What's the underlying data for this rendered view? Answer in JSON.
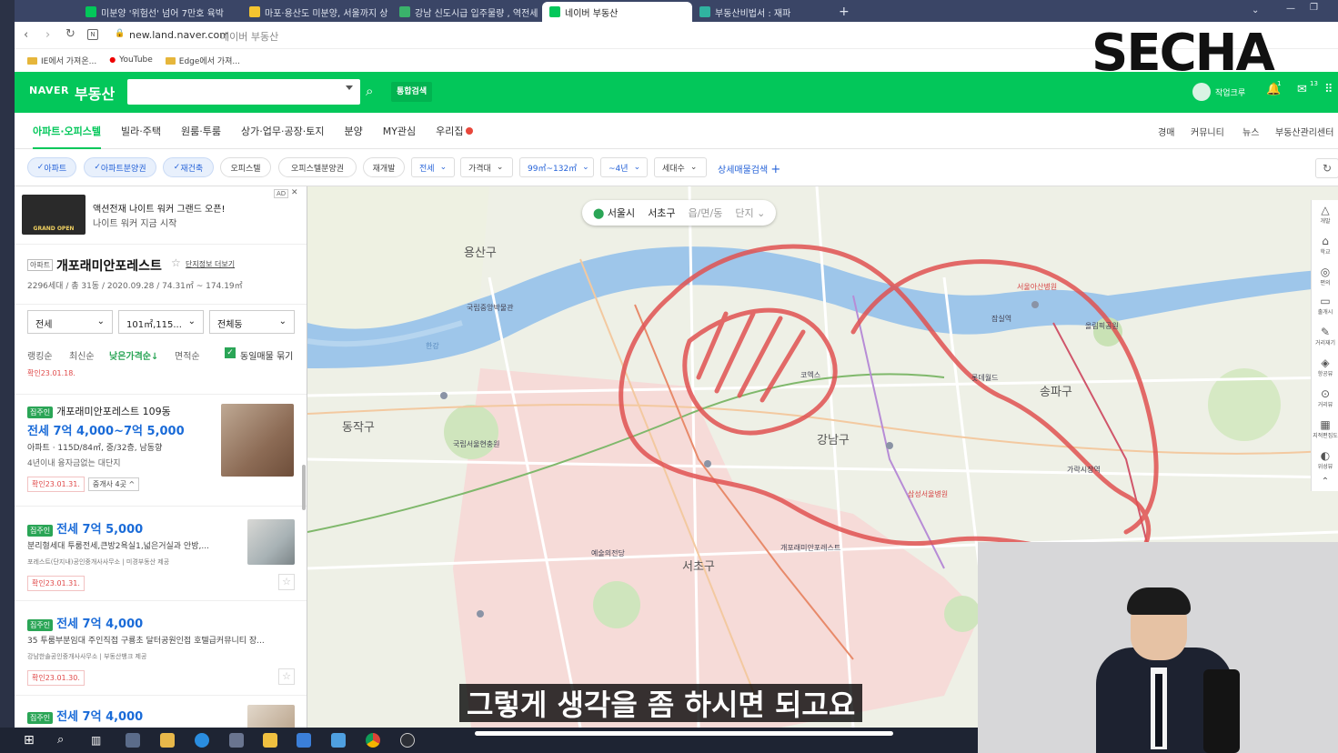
{
  "browser": {
    "tabs": [
      {
        "label": "미분양 '위험선' 넘어 7만호 육박",
        "color": "#03c75a"
      },
      {
        "label": "마포·용산도 미분양, 서울까지 상",
        "color": "#f4c430"
      },
      {
        "label": "강남 신도시급 입주물량 , 역전세",
        "color": "#3ab26b"
      },
      {
        "label": "네이버 부동산",
        "color": "#03c75a"
      },
      {
        "label": "부동산비법서 : 재파",
        "color": "#30b3a0"
      }
    ],
    "new_tab": "+",
    "url": "new.land.naver.com",
    "url_title": "네이버 부동산",
    "bookmarks": [
      "IE에서 가져온...",
      "YouTube",
      "Edge에서 가져..."
    ]
  },
  "header": {
    "brand": "NAVER",
    "service": "부동산",
    "search_placeholder": "",
    "integrated_search": "통합검색",
    "user": "작업크루",
    "notif_count": "1",
    "msg_count": "13"
  },
  "categories": [
    "아파트·오피스텔",
    "빌라·주택",
    "원룸·투룸",
    "상가·업무·공장·토지",
    "분양",
    "MY관심",
    "우리집"
  ],
  "right_links": [
    "경매",
    "커뮤니티",
    "뉴스",
    "부동산관리센터"
  ],
  "filters": {
    "chips_on": [
      "아파트",
      "아파트분양권",
      "재건축"
    ],
    "chips_off": [
      "오피스텔",
      "오피스텔분양권",
      "재개발"
    ],
    "dropdowns": [
      "전세",
      "가격대",
      "99㎡~132㎡",
      "~4년",
      "세대수"
    ],
    "detail": "상세매물검색"
  },
  "ad": {
    "tag": "AD",
    "title": "액션전재 나이트 워커 그랜드 오픈!",
    "sub": "나이트 워커 지금 시작",
    "img_label": "GRAND OPEN"
  },
  "complex": {
    "type": "아파트",
    "name": "개포래미안포레스트",
    "more": "단지정보 더보기",
    "info": "2296세대 / 총 31동 / 2020.09.28 / 74.31㎡ ~ 174.19㎡",
    "sel1": "전세",
    "sel2": "101㎡,115...",
    "sel3": "전체동",
    "sort": [
      "랭킹순",
      "최신순",
      "낮은가격순",
      "면적순"
    ],
    "same_listing": "동일매물 묶기",
    "prev_confirm": "확인23.01.18."
  },
  "listings": [
    {
      "badge": "집주인",
      "title": "개포래미안포레스트 109동",
      "price": "전세 7억 4,000~7억 5,000",
      "spec": "아파트 · 115D/84㎡, 중/32층, 남동향",
      "desc": "4년이내  융자금없는  대단지",
      "confirm": "확인23.01.31.",
      "agents": "중개사 4곳"
    },
    {
      "badge": "집주인",
      "price": "전세 7억 5,000",
      "desc": "분리형세대 투룸전세,큰방2욕실1,넓은거실과 안방,...",
      "agency": "포레스트(단지내)공인중개사사무소  |  미경부동산 제공",
      "confirm": "확인23.01.31."
    },
    {
      "badge": "집주인",
      "price": "전세 7억 4,000",
      "desc": "35 투룸부분임대 주인직접 구룡초 달터공원인접 호텔급커뮤니티 장...",
      "agency": "강남한솔공인중개사사무소  |  부동산뱅크 제공",
      "confirm": "확인23.01.30."
    },
    {
      "badge": "집주인",
      "price": "전세 7억 4,000"
    }
  ],
  "map": {
    "breadcrumb": [
      "서울시",
      "서초구",
      "읍/면/동",
      "단지"
    ],
    "districts": [
      "용산구",
      "동작구",
      "강남구",
      "송파구",
      "서초구"
    ],
    "places": [
      "국립중앙박물관",
      "국립서울현충원",
      "예술의전당",
      "올림픽공원",
      "롯데월드",
      "코엑스",
      "삼성서울병원",
      "개포래미안포레스트",
      "한강",
      "서울아산병원",
      "가락시장역",
      "잠실역"
    ]
  },
  "right_tools": [
    "개발",
    "학교",
    "편의",
    "출개시",
    "거리재기",
    "항공뷰",
    "거리뷰",
    "지적편집도",
    "위성뷰"
  ],
  "subtitle": "그렇게 생각을 좀 하시면 되고요",
  "logo": "SECHA"
}
